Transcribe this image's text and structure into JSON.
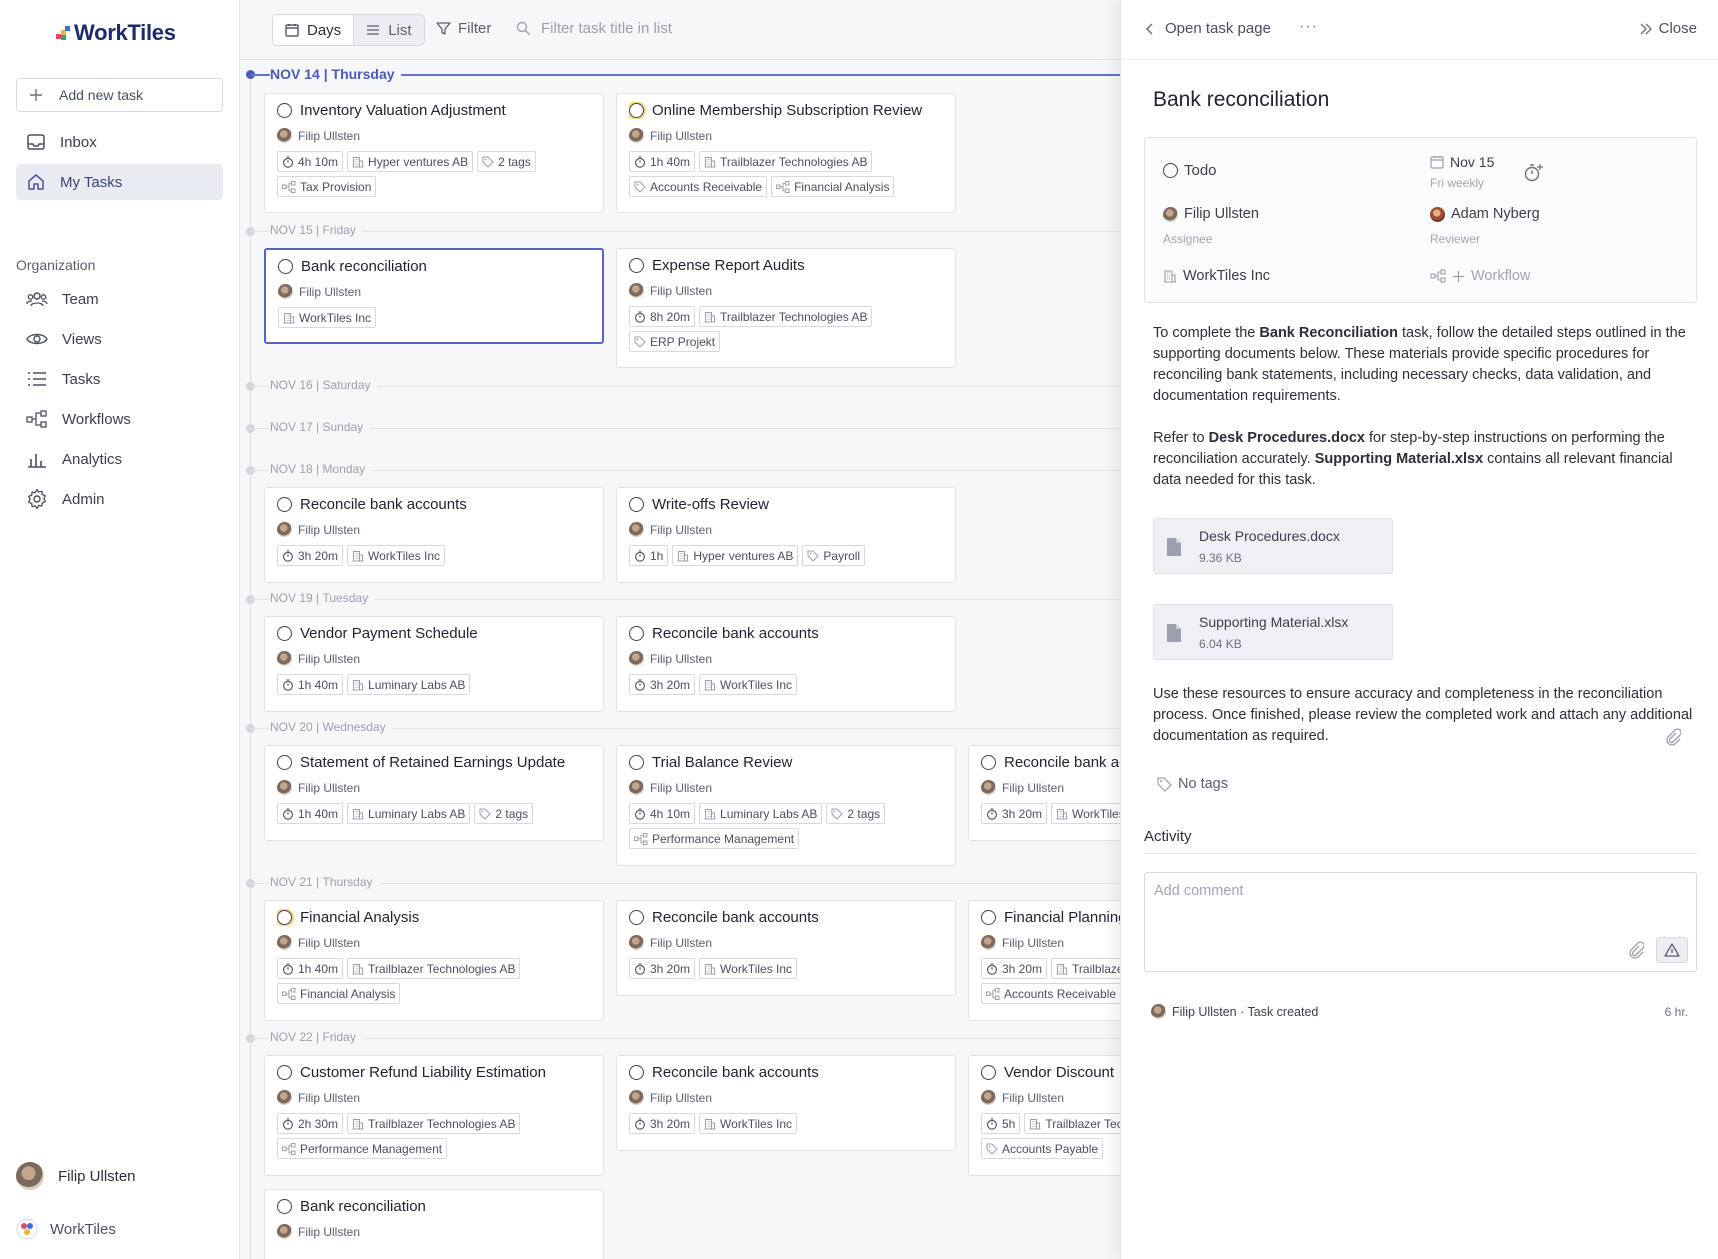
{
  "sidebar": {
    "logo": "WorkTiles",
    "add_task": "Add new task",
    "nav": [
      {
        "label": "Inbox",
        "icon": "inbox-icon"
      },
      {
        "label": "My Tasks",
        "icon": "home-icon",
        "active": true
      }
    ],
    "section": "Organization",
    "org_nav": [
      {
        "label": "Team",
        "icon": "team-icon"
      },
      {
        "label": "Views",
        "icon": "eye-icon"
      },
      {
        "label": "Tasks",
        "icon": "list-icon"
      },
      {
        "label": "Workflows",
        "icon": "workflow-icon"
      },
      {
        "label": "Analytics",
        "icon": "bar-chart-icon"
      },
      {
        "label": "Admin",
        "icon": "gear-icon"
      }
    ],
    "user": "Filip Ullsten",
    "workspace": "WorkTiles"
  },
  "toolbar": {
    "days": "Days",
    "list": "List",
    "filter": "Filter",
    "search_placeholder": "Filter task title in list"
  },
  "days": [
    {
      "date": "NOV 14",
      "weekday": "Thursday",
      "today": true
    },
    {
      "date": "NOV 15",
      "weekday": "Friday"
    },
    {
      "date": "NOV 16",
      "weekday": "Saturday"
    },
    {
      "date": "NOV 17",
      "weekday": "Sunday"
    },
    {
      "date": "NOV 18",
      "weekday": "Monday"
    },
    {
      "date": "NOV 19",
      "weekday": "Tuesday"
    },
    {
      "date": "NOV 20",
      "weekday": "Wednesday"
    },
    {
      "date": "NOV 21",
      "weekday": "Thursday"
    },
    {
      "date": "NOV 22",
      "weekday": "Friday"
    }
  ],
  "cards": [
    {
      "title": "Inventory Valuation Adjustment",
      "assignee": "Filip Ullsten",
      "chips": [
        {
          "t": "4h 10m",
          "i": "timer"
        },
        {
          "t": "Hyper ventures AB",
          "i": "org"
        },
        {
          "t": "2 tags",
          "i": "tag"
        },
        {
          "t": "Tax Provision",
          "i": "wf"
        }
      ]
    },
    {
      "title": "Online Membership Subscription Review",
      "assignee": "Filip Ullsten",
      "warn": true,
      "chips": [
        {
          "t": "1h 40m",
          "i": "timer"
        },
        {
          "t": "Trailblazer Technologies AB",
          "i": "org"
        },
        {
          "t": "Accounts Receivable",
          "i": "tag"
        },
        {
          "t": "Financial Analysis",
          "i": "wf"
        }
      ]
    },
    {
      "title": "Bank reconciliation",
      "assignee": "Filip Ullsten",
      "selected": true,
      "chips": [
        {
          "t": "WorkTiles Inc",
          "i": "org"
        }
      ]
    },
    {
      "title": "Expense Report Audits",
      "assignee": "Filip Ullsten",
      "chips": [
        {
          "t": "8h 20m",
          "i": "timer"
        },
        {
          "t": "Trailblazer Technologies AB",
          "i": "org"
        },
        {
          "t": "ERP Projekt",
          "i": "tag"
        }
      ]
    },
    {
      "title": "Reconcile bank accounts",
      "assignee": "Filip Ullsten",
      "chips": [
        {
          "t": "3h 20m",
          "i": "timer"
        },
        {
          "t": "WorkTiles Inc",
          "i": "org"
        }
      ]
    },
    {
      "title": "Write-offs Review",
      "assignee": "Filip Ullsten",
      "chips": [
        {
          "t": "1h",
          "i": "timer"
        },
        {
          "t": "Hyper ventures AB",
          "i": "org"
        },
        {
          "t": "Payroll",
          "i": "tag"
        }
      ]
    },
    {
      "title": "Vendor Payment Schedule",
      "assignee": "Filip Ullsten",
      "chips": [
        {
          "t": "1h 40m",
          "i": "timer"
        },
        {
          "t": "Luminary Labs AB",
          "i": "org"
        }
      ]
    },
    {
      "title": "Reconcile bank accounts",
      "assignee": "Filip Ullsten",
      "chips": [
        {
          "t": "3h 20m",
          "i": "timer"
        },
        {
          "t": "WorkTiles Inc",
          "i": "org"
        }
      ]
    },
    {
      "title": "Statement of Retained Earnings Update",
      "assignee": "Filip Ullsten",
      "chips": [
        {
          "t": "1h 40m",
          "i": "timer"
        },
        {
          "t": "Luminary Labs AB",
          "i": "org"
        },
        {
          "t": "2 tags",
          "i": "tag"
        }
      ]
    },
    {
      "title": "Trial Balance Review",
      "assignee": "Filip Ullsten",
      "chips": [
        {
          "t": "4h 10m",
          "i": "timer"
        },
        {
          "t": "Luminary Labs AB",
          "i": "org"
        },
        {
          "t": "2 tags",
          "i": "tag"
        },
        {
          "t": "Performance Management",
          "i": "wf"
        }
      ]
    },
    {
      "title": "Reconcile bank accounts",
      "assignee": "Filip Ullsten",
      "chips": [
        {
          "t": "3h 20m",
          "i": "timer"
        },
        {
          "t": "WorkTiles Inc",
          "i": "org"
        }
      ]
    },
    {
      "title": "Financial Analysis",
      "assignee": "Filip Ullsten",
      "warn": true,
      "chips": [
        {
          "t": "1h 40m",
          "i": "timer"
        },
        {
          "t": "Trailblazer Technologies AB",
          "i": "org"
        },
        {
          "t": "Financial Analysis",
          "i": "wf"
        }
      ]
    },
    {
      "title": "Reconcile bank accounts",
      "assignee": "Filip Ullsten",
      "chips": [
        {
          "t": "3h 20m",
          "i": "timer"
        },
        {
          "t": "WorkTiles Inc",
          "i": "org"
        }
      ]
    },
    {
      "title": "Financial Planning",
      "assignee": "Filip Ullsten",
      "chips": [
        {
          "t": "3h 20m",
          "i": "timer"
        },
        {
          "t": "Trailblazer Technologies AB",
          "i": "org"
        },
        {
          "t": "Accounts Receivable",
          "i": "wf"
        }
      ]
    },
    {
      "title": "Customer Refund Liability Estimation",
      "assignee": "Filip Ullsten",
      "chips": [
        {
          "t": "2h 30m",
          "i": "timer"
        },
        {
          "t": "Trailblazer Technologies AB",
          "i": "org"
        },
        {
          "t": "Performance Management",
          "i": "wf"
        }
      ]
    },
    {
      "title": "Reconcile bank accounts",
      "assignee": "Filip Ullsten",
      "chips": [
        {
          "t": "3h 20m",
          "i": "timer"
        },
        {
          "t": "WorkTiles Inc",
          "i": "org"
        }
      ]
    },
    {
      "title": "Vendor Discount",
      "assignee": "Filip Ullsten",
      "chips": [
        {
          "t": "5h",
          "i": "timer"
        },
        {
          "t": "Trailblazer Technologies AB",
          "i": "org"
        },
        {
          "t": "Accounts Payable",
          "i": "tag"
        }
      ]
    },
    {
      "title": "Bank reconciliation",
      "assignee": "Filip Ullsten",
      "chips": []
    }
  ],
  "panel": {
    "open_page": "Open task page",
    "more": "···",
    "close": "Close",
    "title": "Bank reconciliation",
    "status": "Todo",
    "due_date": "Nov 15",
    "recurrence": "Fri weekly",
    "assignee": "Filip Ullsten",
    "assignee_label": "Assignee",
    "reviewer": "Adam Nyberg",
    "reviewer_label": "Reviewer",
    "client": "WorkTiles Inc",
    "workflow": "Workflow",
    "desc1_a": "To complete the ",
    "desc1_b": "Bank Reconciliation",
    "desc1_c": " task, follow the detailed steps outlined in the supporting documents below. These materials provide specific procedures for reconciling bank statements, including necessary checks, data validation, and documentation requirements.",
    "desc2_a": "Refer to ",
    "desc2_b": "Desk Procedures.docx",
    "desc2_c": " for step-by-step instructions on performing the reconciliation accurately. ",
    "desc2_d": "Supporting Material.xlsx",
    "desc2_e": " contains all relevant financial data needed for this task.",
    "attachments": [
      {
        "name": "Desk Procedures.docx",
        "size": "9.36 KB"
      },
      {
        "name": "Supporting Material.xlsx",
        "size": "6.04 KB"
      }
    ],
    "desc3": "Use these resources to ensure accuracy and completeness in the reconciliation process. Once finished, please review the completed work and attach any additional documentation as required.",
    "tags": "No tags",
    "activity": "Activity",
    "comment_placeholder": "Add comment",
    "log_user": "Filip Ullsten",
    "log_text": " · Task created",
    "log_time": "6 hr."
  },
  "colors": {
    "accent": "#5664c2",
    "brand": "#1f2a6b",
    "warn": "#f7d77a"
  }
}
